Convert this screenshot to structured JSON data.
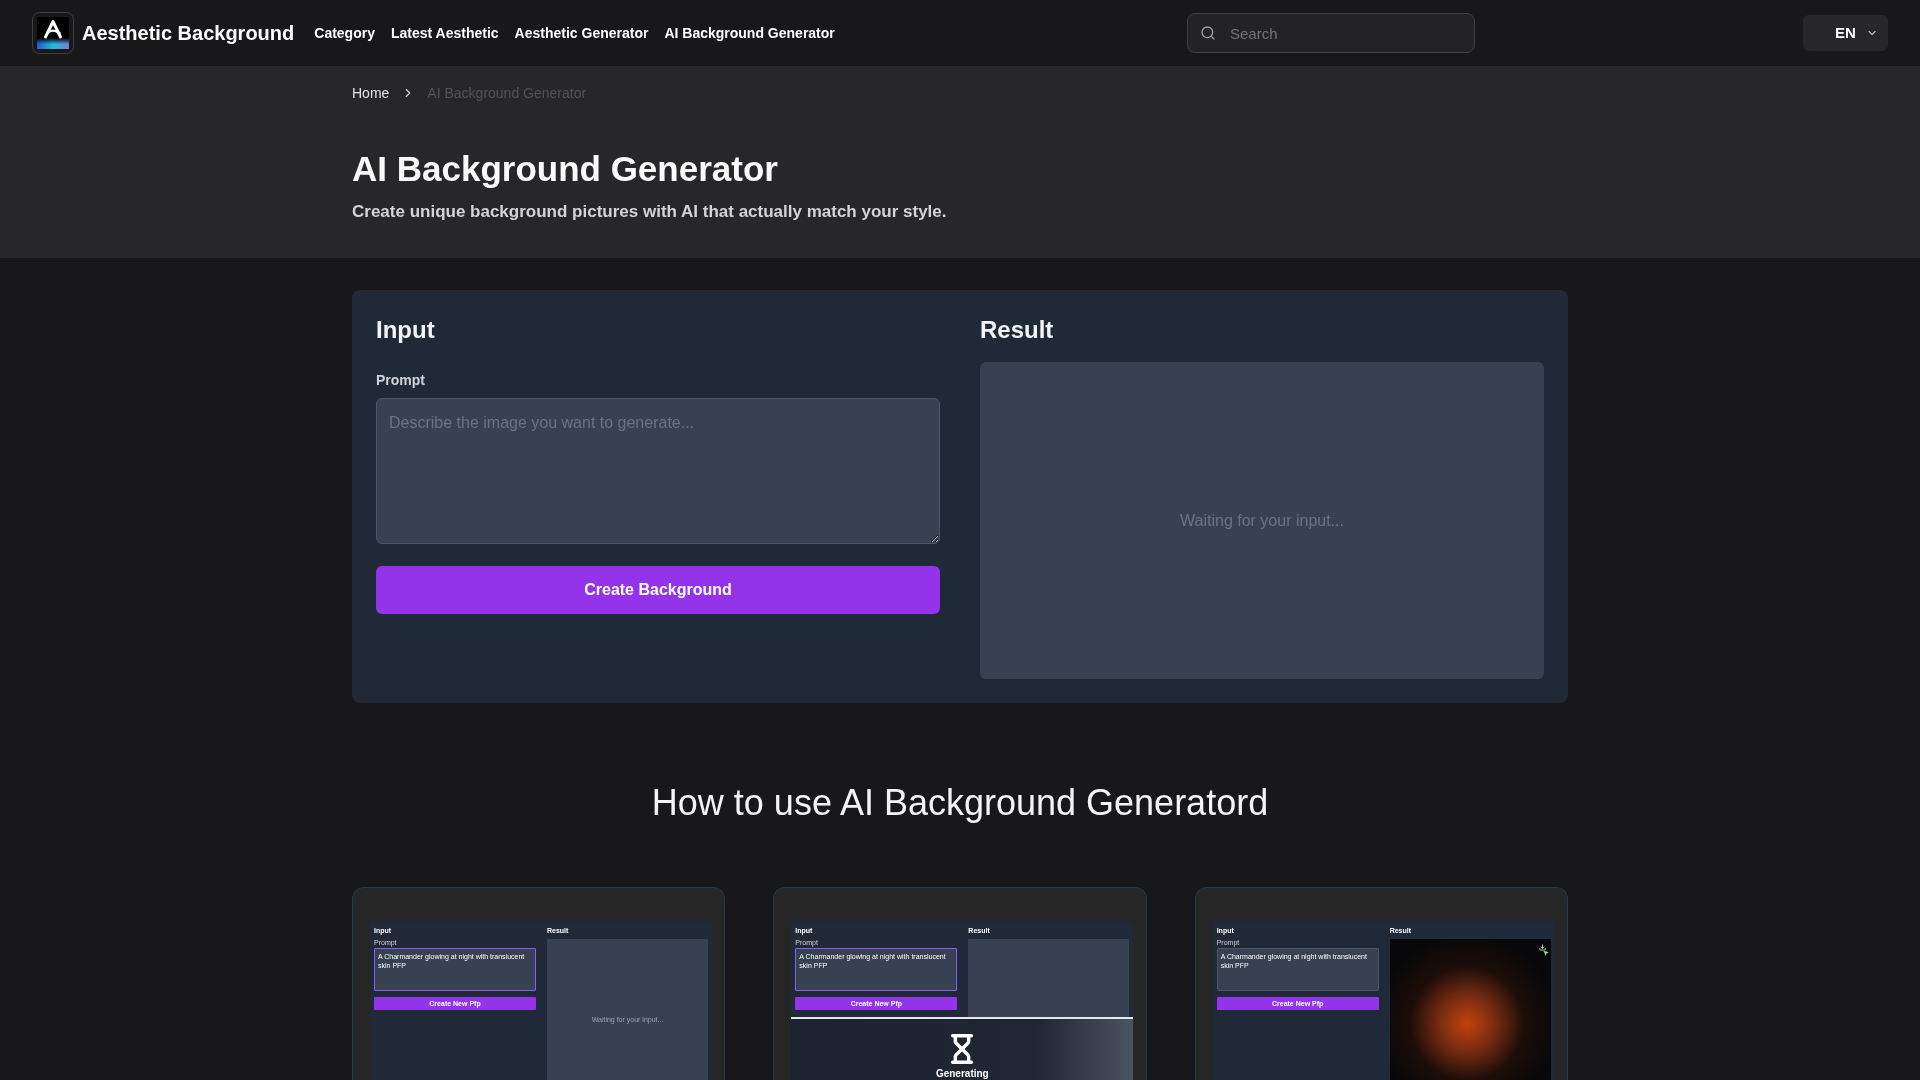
{
  "header": {
    "site_title": "Aesthetic Background",
    "nav": [
      "Category",
      "Latest Aesthetic",
      "Aesthetic Generator",
      "AI Background Generator"
    ],
    "search": {
      "placeholder": "Search"
    },
    "language": "EN"
  },
  "breadcrumb": [
    {
      "label": "Home",
      "current": false
    },
    {
      "label": "AI Background Generator",
      "current": true
    }
  ],
  "hero": {
    "title": "AI Background Generator",
    "subtitle": "Create unique background pictures with AI that actually match your style."
  },
  "generator": {
    "input": {
      "heading": "Input",
      "prompt_label": "Prompt",
      "placeholder": "Describe the image you want to generate...",
      "button": "Create Background"
    },
    "result": {
      "heading": "Result",
      "status": "Waiting for your input..."
    }
  },
  "how_to": {
    "heading": "How to use AI Background Generatord",
    "steps": [
      {
        "kind": "waiting",
        "input_heading": "Input",
        "prompt_label": "Prompt",
        "prompt": "A Charmander glowing at night with translucent skin PFP",
        "focused": true,
        "button": "Create New Pfp",
        "result_heading": "Result",
        "result_status": "Waiting for your input..."
      },
      {
        "kind": "generating",
        "input_heading": "Input",
        "prompt_label": "Prompt",
        "prompt": "A Charmander glowing at night with translucent skin PFP",
        "focused": true,
        "button": "Create New Pfp",
        "result_heading": "Result",
        "overlay_label": "Generating"
      },
      {
        "kind": "done",
        "input_heading": "Input",
        "prompt_label": "Prompt",
        "prompt": "A Charmander glowing at night with translucent skin PFP",
        "focused": false,
        "button": "Create New Pfp",
        "result_heading": "Result"
      }
    ]
  }
}
